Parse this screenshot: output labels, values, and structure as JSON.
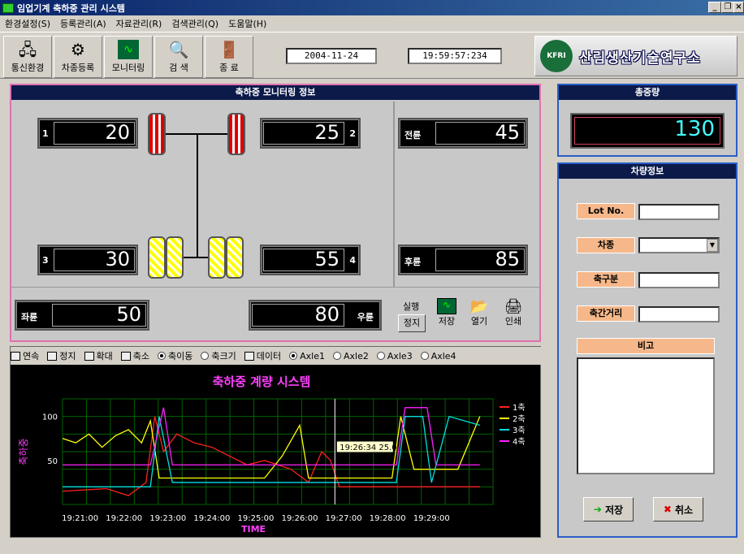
{
  "window": {
    "title": "임업기계 축하중 관리 시스템"
  },
  "menu": [
    "환경설정(S)",
    "등록관리(A)",
    "자료관리(R)",
    "검색관리(Q)",
    "도움말(H)"
  ],
  "toolbar": {
    "buttons": [
      {
        "label": "통신환경",
        "icon": "network-icon"
      },
      {
        "label": "차종등록",
        "icon": "register-icon"
      },
      {
        "label": "모니터링",
        "icon": "monitor-icon"
      },
      {
        "label": "검  색",
        "icon": "search-icon"
      },
      {
        "label": "종  료",
        "icon": "exit-icon"
      }
    ],
    "date": "2004-11-24",
    "time": "19:59:57:234",
    "logo_text": "산림생산기술연구소",
    "logo_emblem": "KFRI"
  },
  "monitor": {
    "title": "축하중 모니터링 정보",
    "wheels": [
      {
        "id": "1",
        "value": "20"
      },
      {
        "id": "2",
        "value": "25"
      },
      {
        "id": "3",
        "value": "30"
      },
      {
        "id": "4",
        "value": "55"
      }
    ],
    "front": {
      "label": "전륜",
      "value": "45"
    },
    "rear": {
      "label": "후륜",
      "value": "85"
    },
    "left": {
      "label": "좌륜",
      "value": "50"
    },
    "right": {
      "label": "우륜",
      "value": "80"
    },
    "run_label": "실행",
    "stop_label": "정지",
    "save_label": "저장",
    "open_label": "열기",
    "print_label": "인쇄"
  },
  "chart_toolbar": {
    "continuous": "연속",
    "stop": "정지",
    "zoom_in": "확대",
    "zoom_out": "축소",
    "axis_move": "축이동",
    "axis_size": "축크기",
    "data": "데이터",
    "axles": [
      "Axle1",
      "Axle2",
      "Axle3",
      "Axle4"
    ]
  },
  "chart_data": {
    "type": "line",
    "title": "축하중 계량 시스템",
    "xlabel": "TIME",
    "ylabel": "축하중",
    "x_ticks": [
      "19:21:00",
      "19:22:00",
      "19:23:00",
      "19:24:00",
      "19:25:00",
      "19:26:00",
      "19:27:00",
      "19:28:00",
      "19:29:00"
    ],
    "y_ticks": [
      50,
      100
    ],
    "ylim": [
      0,
      120
    ],
    "cursor_label": "19:26:34  25.0",
    "legend": [
      {
        "name": "1축",
        "color": "#ff2020"
      },
      {
        "name": "2축",
        "color": "#ffff00"
      },
      {
        "name": "3축",
        "color": "#00e0e0"
      },
      {
        "name": "4축",
        "color": "#ff20ff"
      }
    ],
    "series": [
      {
        "name": "1축",
        "color": "#ff2020",
        "points": [
          [
            0,
            15
          ],
          [
            1,
            18
          ],
          [
            1.5,
            10
          ],
          [
            1.9,
            25
          ],
          [
            2.1,
            100
          ],
          [
            2.3,
            60
          ],
          [
            2.6,
            80
          ],
          [
            3,
            70
          ],
          [
            3.4,
            65
          ],
          [
            3.8,
            55
          ],
          [
            4.2,
            45
          ],
          [
            4.6,
            50
          ],
          [
            5.2,
            40
          ],
          [
            5.6,
            25
          ],
          [
            5.9,
            60
          ],
          [
            6.1,
            50
          ],
          [
            6.3,
            20
          ],
          [
            7,
            20
          ],
          [
            7.5,
            20
          ],
          [
            8,
            20
          ],
          [
            8.5,
            20
          ],
          [
            9.5,
            20
          ]
        ]
      },
      {
        "name": "2축",
        "color": "#ffff00",
        "points": [
          [
            0,
            75
          ],
          [
            0.3,
            70
          ],
          [
            0.6,
            80
          ],
          [
            0.9,
            65
          ],
          [
            1.2,
            78
          ],
          [
            1.5,
            85
          ],
          [
            1.8,
            70
          ],
          [
            2,
            95
          ],
          [
            2.2,
            30
          ],
          [
            2.5,
            30
          ],
          [
            3,
            30
          ],
          [
            3.5,
            30
          ],
          [
            4,
            30
          ],
          [
            4.6,
            30
          ],
          [
            5,
            55
          ],
          [
            5.4,
            90
          ],
          [
            5.6,
            30
          ],
          [
            6.5,
            30
          ],
          [
            7.5,
            30
          ],
          [
            7.7,
            100
          ],
          [
            8,
            40
          ],
          [
            8.5,
            40
          ],
          [
            9,
            40
          ],
          [
            9.5,
            100
          ]
        ]
      },
      {
        "name": "3축",
        "color": "#00e0e0",
        "points": [
          [
            0,
            20
          ],
          [
            1,
            20
          ],
          [
            2,
            20
          ],
          [
            2.2,
            100
          ],
          [
            2.5,
            25
          ],
          [
            3,
            25
          ],
          [
            4,
            25
          ],
          [
            5,
            25
          ],
          [
            6,
            25
          ],
          [
            7,
            25
          ],
          [
            7.6,
            25
          ],
          [
            7.8,
            100
          ],
          [
            8.2,
            100
          ],
          [
            8.4,
            25
          ],
          [
            8.8,
            100
          ],
          [
            9.5,
            90
          ]
        ]
      },
      {
        "name": "4축",
        "color": "#ff20ff",
        "points": [
          [
            0,
            45
          ],
          [
            1,
            45
          ],
          [
            2,
            45
          ],
          [
            2.3,
            110
          ],
          [
            2.5,
            45
          ],
          [
            3,
            45
          ],
          [
            4,
            45
          ],
          [
            5,
            45
          ],
          [
            6,
            45
          ],
          [
            7,
            45
          ],
          [
            7.6,
            45
          ],
          [
            7.8,
            110
          ],
          [
            8.3,
            110
          ],
          [
            8.5,
            45
          ],
          [
            9,
            45
          ],
          [
            9.5,
            45
          ]
        ]
      }
    ]
  },
  "total": {
    "title": "총중량",
    "value": "130"
  },
  "vehicle": {
    "title": "차량정보",
    "fields": [
      {
        "label": "Lot No.",
        "value": ""
      },
      {
        "label": "차종",
        "value": ""
      },
      {
        "label": "축구분",
        "value": ""
      },
      {
        "label": "축간거리",
        "value": ""
      }
    ],
    "remark_label": "비고",
    "remark": "",
    "save": "저장",
    "cancel": "취소"
  }
}
